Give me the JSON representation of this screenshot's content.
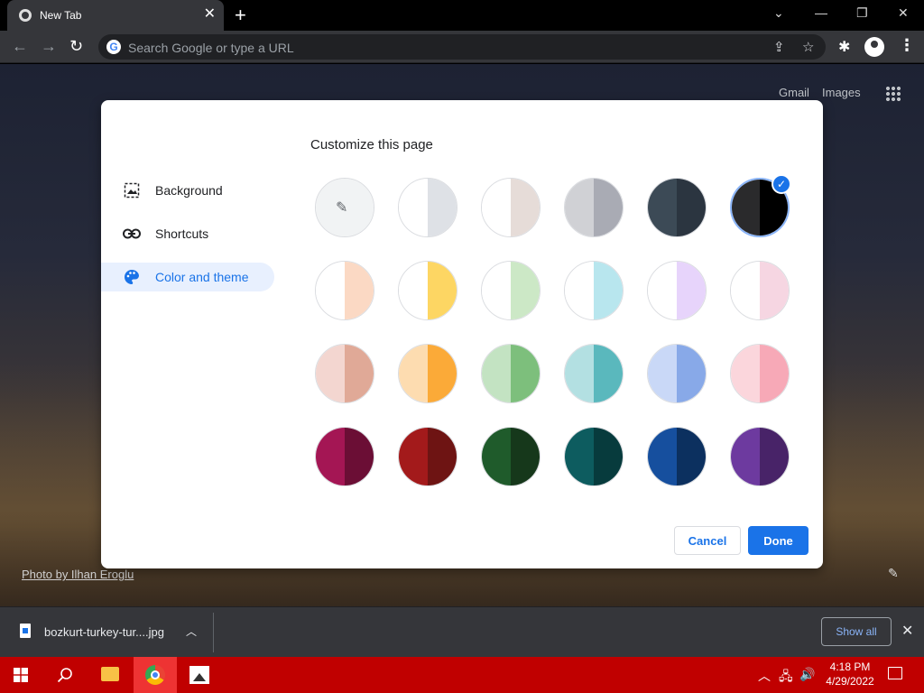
{
  "browser": {
    "tab_title": "New Tab",
    "omnibox_placeholder": "Search Google or type a URL",
    "icons": {
      "back": "arrow-left-icon",
      "forward": "arrow-right-icon",
      "reload": "reload-icon",
      "share": "share-icon",
      "bookmark": "star-icon",
      "extensions": "puzzle-icon",
      "profile": "profile-icon",
      "menu": "kebab-menu-icon"
    }
  },
  "ntp": {
    "gmail": "Gmail",
    "images": "Images",
    "photo_credit": "Photo by Ilhan Eroglu"
  },
  "dialog": {
    "title": "Customize this page",
    "menu": [
      {
        "label": "Background",
        "icon": "image-icon",
        "active": false
      },
      {
        "label": "Shortcuts",
        "icon": "link-icon",
        "active": false
      },
      {
        "label": "Color and theme",
        "icon": "palette-icon",
        "active": true
      }
    ],
    "swatches": [
      [
        {
          "left": "#f1f3f4",
          "right": "#f1f3f4",
          "picker": true
        },
        {
          "left": "#ffffff",
          "right": "#dee1e6"
        },
        {
          "left": "#ffffff",
          "right": "#e6dcd8"
        },
        {
          "left": "#d0d1d5",
          "right": "#a9abb4"
        },
        {
          "left": "#3c4a56",
          "right": "#2b3540"
        },
        {
          "left": "#2a2a2c",
          "right": "#000000",
          "selected": true
        }
      ],
      [
        {
          "left": "#ffffff",
          "right": "#fbd9c4"
        },
        {
          "left": "#ffffff",
          "right": "#fdd663"
        },
        {
          "left": "#ffffff",
          "right": "#cce8c6"
        },
        {
          "left": "#ffffff",
          "right": "#b8e6ee"
        },
        {
          "left": "#ffffff",
          "right": "#e7d4fb"
        },
        {
          "left": "#ffffff",
          "right": "#f6d6e2"
        }
      ],
      [
        {
          "left": "#f3d6d0",
          "right": "#e0a997"
        },
        {
          "left": "#fddcb0",
          "right": "#fbaa38"
        },
        {
          "left": "#c3e3c2",
          "right": "#7dbf7c"
        },
        {
          "left": "#b3e0e2",
          "right": "#5ab8bd"
        },
        {
          "left": "#c9d8f7",
          "right": "#88a9e8"
        },
        {
          "left": "#fbd6dc",
          "right": "#f7a9b7"
        }
      ],
      [
        {
          "left": "#a41654",
          "right": "#6b0e35"
        },
        {
          "left": "#a31a1b",
          "right": "#6e1413"
        },
        {
          "left": "#1f5b2b",
          "right": "#16381b"
        },
        {
          "left": "#0d5c5f",
          "right": "#073b3d"
        },
        {
          "left": "#164f9e",
          "right": "#0c305f"
        },
        {
          "left": "#6d3a9f",
          "right": "#482368"
        }
      ]
    ],
    "cancel": "Cancel",
    "done": "Done"
  },
  "download": {
    "file_name": "bozkurt-turkey-tur....jpg",
    "show_all": "Show all"
  },
  "taskbar": {
    "time": "4:18 PM",
    "date": "4/29/2022",
    "accent": "#c00000"
  }
}
